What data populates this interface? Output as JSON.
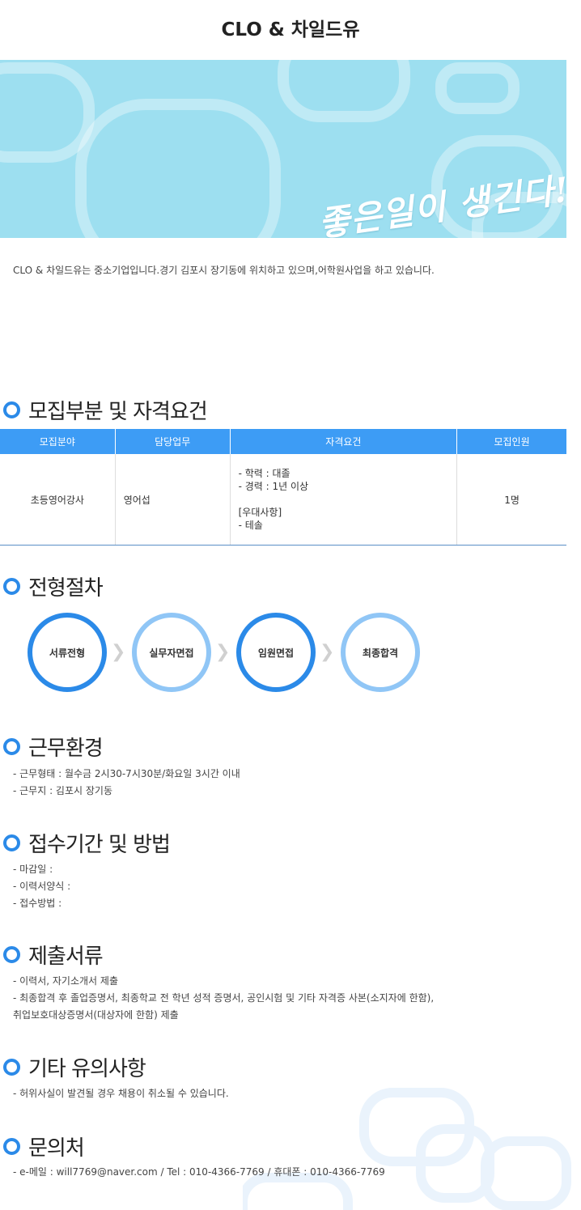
{
  "header": {
    "title": "CLO & 차일드유"
  },
  "banner": {
    "slogan": "좋은일이 생긴다!"
  },
  "intro": "CLO & 차일드유는 중소기업입니다.경기 김포시 장기동에 위치하고 있으며,어학원사업을 하고 있습니다.",
  "sections": {
    "recruit": "모집부분 및 자격요건",
    "process": "전형절차",
    "environment": "근무환경",
    "application": "접수기간 및 방법",
    "documents": "제출서류",
    "notes": "기타 유의사항",
    "contact": "문의처"
  },
  "table": {
    "headers": [
      "모집분야",
      "담당업무",
      "자격요건",
      "모집인원"
    ],
    "row": {
      "field": "초등영어강사",
      "duty": "영어섭",
      "requirements": [
        "- 학력 : 대졸",
        "- 경력 : 1년 이상",
        "",
        "[우대사항]",
        "- 테솔"
      ],
      "count": "1명"
    }
  },
  "process_steps": [
    "서류전형",
    "실무자면접",
    "임원면접",
    "최종합격"
  ],
  "environment": [
    "- 근무형태 : 월수금 2시30-7시30분/화요일 3시간 이내",
    "- 근무지 : 김포시 장기동"
  ],
  "application": [
    "- 마감일 :",
    "- 이력서양식 :",
    "- 접수방법 :"
  ],
  "documents": [
    "- 이력서, 자기소개서 제출",
    "- 최종합격 후 졸업증명서, 최종학교 전 학년 성적 증명서, 공인시험 및 기타 자격증 사본(소지자에 한함),",
    "취업보호대상증명서(대상자에 한함) 제출"
  ],
  "notes": [
    "- 허위사실이 발견될 경우 채용이 취소될 수 있습니다."
  ],
  "contact": [
    "- e-메일 : will7769@naver.com / Tel : 010-4366-7769 / 휴대폰 : 010-4366-7769"
  ],
  "colors": {
    "accent": "#2b8ae8",
    "header_bg": "#3d9cf5",
    "banner_bg": "#9ddff0"
  }
}
